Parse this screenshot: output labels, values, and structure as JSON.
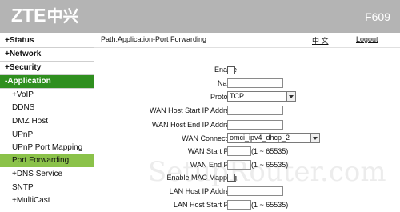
{
  "header": {
    "logo_latin": "ZTE",
    "logo_cn": "中兴",
    "model": "F609"
  },
  "sidebar": {
    "items": [
      {
        "label": "+Status"
      },
      {
        "label": "+Network"
      },
      {
        "label": "+Security"
      },
      {
        "label": "-Application"
      },
      {
        "label": "+VoIP"
      },
      {
        "label": "DDNS"
      },
      {
        "label": "DMZ Host"
      },
      {
        "label": "UPnP"
      },
      {
        "label": "UPnP Port Mapping"
      },
      {
        "label": "Port Forwarding"
      },
      {
        "label": "+DNS Service"
      },
      {
        "label": "SNTP"
      },
      {
        "label": "+MultiCast"
      }
    ]
  },
  "pathbar": {
    "path": "Path:Application-Port Forwarding",
    "language": "中 文",
    "logout": "Logout"
  },
  "form": {
    "enable": "Enable",
    "name": "Name",
    "protocol": "Protocol",
    "protocol_value": "TCP",
    "wan_host_start_ip": "WAN Host Start IP Address",
    "wan_host_end_ip": "WAN Host End IP Address",
    "wan_connection": "WAN Connection",
    "wan_connection_value": "omci_ipv4_dhcp_2",
    "wan_start_port": "WAN Start Port",
    "wan_start_port_hint": "(1 ~ 65535)",
    "wan_end_port": "WAN End Port",
    "wan_end_port_hint": "(1 ~ 65535)",
    "enable_mac_mapping": "Enable MAC Mapping",
    "lan_host_ip": "LAN Host IP Address",
    "lan_host_start_port": "LAN Host Start Port",
    "lan_host_start_port_hint": "(1 ~ 65535)"
  },
  "watermark": "SetupRouter.com"
}
